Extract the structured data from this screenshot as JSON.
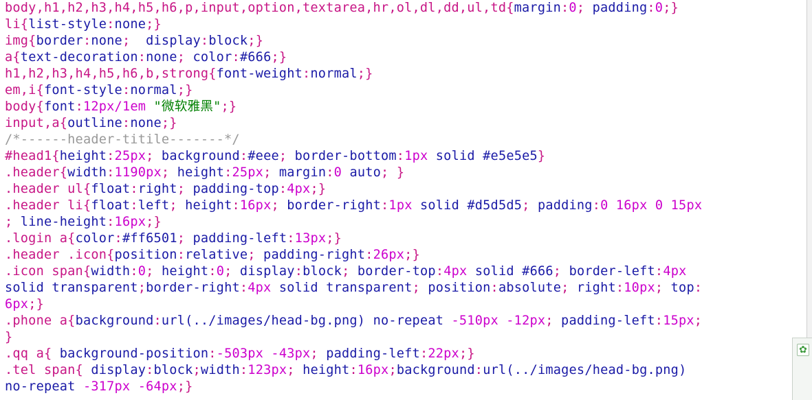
{
  "editor": {
    "lines": [
      [
        [
          "sel",
          "body,h1,h2,h3,h4,h5,h6,p,input,option,textarea,hr,ol,dl,dd,ul,td{"
        ],
        [
          "prop",
          "margin"
        ],
        [
          "punc",
          ":"
        ],
        [
          "num",
          "0"
        ],
        [
          "punc",
          ";"
        ],
        [
          "prop",
          " padding"
        ],
        [
          "punc",
          ":"
        ],
        [
          "num",
          "0"
        ],
        [
          "punc",
          ";}"
        ]
      ],
      [
        [
          "sel",
          "li{"
        ],
        [
          "prop",
          "list-style"
        ],
        [
          "punc",
          ":"
        ],
        [
          "val",
          "none"
        ],
        [
          "punc",
          ";}"
        ]
      ],
      [
        [
          "sel",
          "img{"
        ],
        [
          "prop",
          "border"
        ],
        [
          "punc",
          ":"
        ],
        [
          "val",
          "none"
        ],
        [
          "punc",
          ";"
        ],
        [
          "prop",
          "  display"
        ],
        [
          "punc",
          ":"
        ],
        [
          "val",
          "block"
        ],
        [
          "punc",
          ";}"
        ]
      ],
      [
        [
          "sel",
          "a{"
        ],
        [
          "prop",
          "text-decoration"
        ],
        [
          "punc",
          ":"
        ],
        [
          "val",
          "none"
        ],
        [
          "punc",
          ";"
        ],
        [
          "prop",
          " color"
        ],
        [
          "punc",
          ":"
        ],
        [
          "val",
          "#666"
        ],
        [
          "punc",
          ";}"
        ]
      ],
      [
        [
          "sel",
          "h1,h2,h3,h4,h5,h6,b,strong{"
        ],
        [
          "prop",
          "font-weight"
        ],
        [
          "punc",
          ":"
        ],
        [
          "val",
          "normal"
        ],
        [
          "punc",
          ";}"
        ]
      ],
      [
        [
          "sel",
          "em,i{"
        ],
        [
          "prop",
          "font-style"
        ],
        [
          "punc",
          ":"
        ],
        [
          "val",
          "normal"
        ],
        [
          "punc",
          ";}"
        ]
      ],
      [
        [
          "sel",
          "body{"
        ],
        [
          "prop",
          "font"
        ],
        [
          "punc",
          ":"
        ],
        [
          "num",
          "12px/1em"
        ],
        [
          "val",
          " "
        ],
        [
          "str",
          "\"微软雅黑\""
        ],
        [
          "punc",
          ";}"
        ]
      ],
      [
        [
          "sel",
          "input,a{"
        ],
        [
          "prop",
          "outline"
        ],
        [
          "punc",
          ":"
        ],
        [
          "val",
          "none"
        ],
        [
          "punc",
          ";}"
        ]
      ],
      [
        [
          "com",
          "/*------header-titile-------*/"
        ]
      ],
      [
        [
          "sel",
          "#head1{"
        ],
        [
          "prop",
          "height"
        ],
        [
          "punc",
          ":"
        ],
        [
          "num",
          "25px"
        ],
        [
          "punc",
          ";"
        ],
        [
          "prop",
          " background"
        ],
        [
          "punc",
          ":"
        ],
        [
          "val",
          "#eee"
        ],
        [
          "punc",
          ";"
        ],
        [
          "prop",
          " border-bottom"
        ],
        [
          "punc",
          ":"
        ],
        [
          "num",
          "1px"
        ],
        [
          "val",
          " solid #e5e5e5"
        ],
        [
          "punc",
          "}"
        ]
      ],
      [
        [
          "sel",
          ".header{"
        ],
        [
          "prop",
          "width"
        ],
        [
          "punc",
          ":"
        ],
        [
          "num",
          "1190px"
        ],
        [
          "punc",
          ";"
        ],
        [
          "prop",
          " height"
        ],
        [
          "punc",
          ":"
        ],
        [
          "num",
          "25px"
        ],
        [
          "punc",
          ";"
        ],
        [
          "prop",
          " margin"
        ],
        [
          "punc",
          ":"
        ],
        [
          "num",
          "0"
        ],
        [
          "val",
          " auto"
        ],
        [
          "punc",
          "; }"
        ]
      ],
      [
        [
          "sel",
          ".header ul{"
        ],
        [
          "prop",
          "float"
        ],
        [
          "punc",
          ":"
        ],
        [
          "val",
          "right"
        ],
        [
          "punc",
          ";"
        ],
        [
          "prop",
          " padding-top"
        ],
        [
          "punc",
          ":"
        ],
        [
          "num",
          "4px"
        ],
        [
          "punc",
          ";}"
        ]
      ],
      [
        [
          "sel",
          ".header li{"
        ],
        [
          "prop",
          "float"
        ],
        [
          "punc",
          ":"
        ],
        [
          "val",
          "left"
        ],
        [
          "punc",
          ";"
        ],
        [
          "prop",
          " height"
        ],
        [
          "punc",
          ":"
        ],
        [
          "num",
          "16px"
        ],
        [
          "punc",
          ";"
        ],
        [
          "prop",
          " border-right"
        ],
        [
          "punc",
          ":"
        ],
        [
          "num",
          "1px"
        ],
        [
          "val",
          " solid #d5d5d5"
        ],
        [
          "punc",
          ";"
        ],
        [
          "prop",
          " padding"
        ],
        [
          "punc",
          ":"
        ],
        [
          "num",
          "0 16px 0 15px"
        ]
      ],
      [
        [
          "punc",
          "; "
        ],
        [
          "prop",
          "line-height"
        ],
        [
          "punc",
          ":"
        ],
        [
          "num",
          "16px"
        ],
        [
          "punc",
          ";}"
        ]
      ],
      [
        [
          "sel",
          ".login a{"
        ],
        [
          "prop",
          "color"
        ],
        [
          "punc",
          ":"
        ],
        [
          "val",
          "#ff6501"
        ],
        [
          "punc",
          ";"
        ],
        [
          "prop",
          " padding-left"
        ],
        [
          "punc",
          ":"
        ],
        [
          "num",
          "13px"
        ],
        [
          "punc",
          ";}"
        ]
      ],
      [
        [
          "sel",
          ".header .icon{"
        ],
        [
          "prop",
          "position"
        ],
        [
          "punc",
          ":"
        ],
        [
          "val",
          "relative"
        ],
        [
          "punc",
          ";"
        ],
        [
          "prop",
          " padding-right"
        ],
        [
          "punc",
          ":"
        ],
        [
          "num",
          "26px"
        ],
        [
          "punc",
          ";}"
        ]
      ],
      [
        [
          "sel",
          ".icon span{"
        ],
        [
          "prop",
          "width"
        ],
        [
          "punc",
          ":"
        ],
        [
          "num",
          "0"
        ],
        [
          "punc",
          ";"
        ],
        [
          "prop",
          " height"
        ],
        [
          "punc",
          ":"
        ],
        [
          "num",
          "0"
        ],
        [
          "punc",
          ";"
        ],
        [
          "prop",
          " display"
        ],
        [
          "punc",
          ":"
        ],
        [
          "val",
          "block"
        ],
        [
          "punc",
          ";"
        ],
        [
          "prop",
          " border-top"
        ],
        [
          "punc",
          ":"
        ],
        [
          "num",
          "4px"
        ],
        [
          "val",
          " solid #666"
        ],
        [
          "punc",
          ";"
        ],
        [
          "prop",
          " border-left"
        ],
        [
          "punc",
          ":"
        ],
        [
          "num",
          "4px"
        ]
      ],
      [
        [
          "val",
          "solid transparent"
        ],
        [
          "punc",
          ";"
        ],
        [
          "prop",
          "border-right"
        ],
        [
          "punc",
          ":"
        ],
        [
          "num",
          "4px"
        ],
        [
          "val",
          " solid transparent"
        ],
        [
          "punc",
          ";"
        ],
        [
          "prop",
          " position"
        ],
        [
          "punc",
          ":"
        ],
        [
          "val",
          "absolute"
        ],
        [
          "punc",
          ";"
        ],
        [
          "prop",
          " right"
        ],
        [
          "punc",
          ":"
        ],
        [
          "num",
          "10px"
        ],
        [
          "punc",
          ";"
        ],
        [
          "prop",
          " top"
        ],
        [
          "punc",
          ":"
        ]
      ],
      [
        [
          "num",
          "6px"
        ],
        [
          "punc",
          ";}"
        ]
      ],
      [
        [
          "sel",
          ".phone a{"
        ],
        [
          "prop",
          "background"
        ],
        [
          "punc",
          ":"
        ],
        [
          "val",
          "url(../images/head-bg.png) no-repeat "
        ],
        [
          "num",
          "-510px -12px"
        ],
        [
          "punc",
          ";"
        ],
        [
          "prop",
          " padding-left"
        ],
        [
          "punc",
          ":"
        ],
        [
          "num",
          "15px"
        ],
        [
          "punc",
          ";"
        ]
      ],
      [
        [
          "punc",
          "}"
        ]
      ],
      [
        [
          "sel",
          ".qq a{"
        ],
        [
          "prop",
          " background-position"
        ],
        [
          "punc",
          ":"
        ],
        [
          "num",
          "-503px -43px"
        ],
        [
          "punc",
          ";"
        ],
        [
          "prop",
          " padding-left"
        ],
        [
          "punc",
          ":"
        ],
        [
          "num",
          "22px"
        ],
        [
          "punc",
          ";}"
        ]
      ],
      [
        [
          "sel",
          ".tel span{"
        ],
        [
          "prop",
          " display"
        ],
        [
          "punc",
          ":"
        ],
        [
          "val",
          "block"
        ],
        [
          "punc",
          ";"
        ],
        [
          "prop",
          "width"
        ],
        [
          "punc",
          ":"
        ],
        [
          "num",
          "123px"
        ],
        [
          "punc",
          ";"
        ],
        [
          "prop",
          " height"
        ],
        [
          "punc",
          ":"
        ],
        [
          "num",
          "16px"
        ],
        [
          "punc",
          ";"
        ],
        [
          "prop",
          "background"
        ],
        [
          "punc",
          ":"
        ],
        [
          "val",
          "url(../images/head-bg.png)"
        ]
      ],
      [
        [
          "val",
          "no-repeat "
        ],
        [
          "num",
          "-317px -64px"
        ],
        [
          "punc",
          ";}"
        ]
      ]
    ]
  },
  "side_panel": {
    "icon": "plugin-icon"
  }
}
